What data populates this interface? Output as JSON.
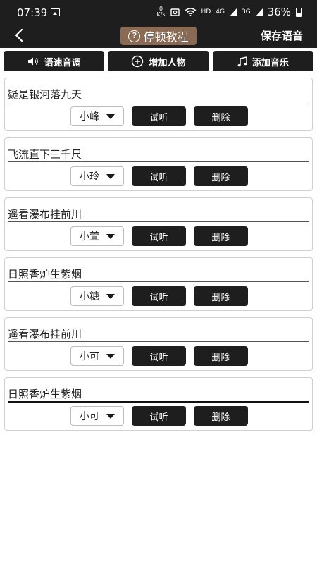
{
  "status_bar": {
    "time": "07:39",
    "net_speed_value": "0",
    "net_speed_unit": "K/s",
    "hd": "HD",
    "lte": "4G",
    "sig3g": "3G",
    "battery": "36%"
  },
  "header": {
    "title": "停顿教程",
    "save_label": "保存语音"
  },
  "toolbar": {
    "speed_pitch": "语速音调",
    "add_character": "增加人物",
    "add_music": "添加音乐"
  },
  "lines": [
    {
      "text": "疑是银河落九天",
      "voice": "小峰",
      "listen": "试听",
      "delete": "删除"
    },
    {
      "text": "飞流直下三千尺",
      "voice": "小玲",
      "listen": "试听",
      "delete": "删除"
    },
    {
      "text": "遥看瀑布挂前川",
      "voice": "小萱",
      "listen": "试听",
      "delete": "删除"
    },
    {
      "text": "日照香炉生紫烟",
      "voice": "小糖",
      "listen": "试听",
      "delete": "删除"
    },
    {
      "text": "遥看瀑布挂前川",
      "voice": "小可",
      "listen": "试听",
      "delete": "删除"
    },
    {
      "text": "日照香炉生紫烟",
      "voice": "小可",
      "listen": "试听",
      "delete": "删除"
    }
  ]
}
